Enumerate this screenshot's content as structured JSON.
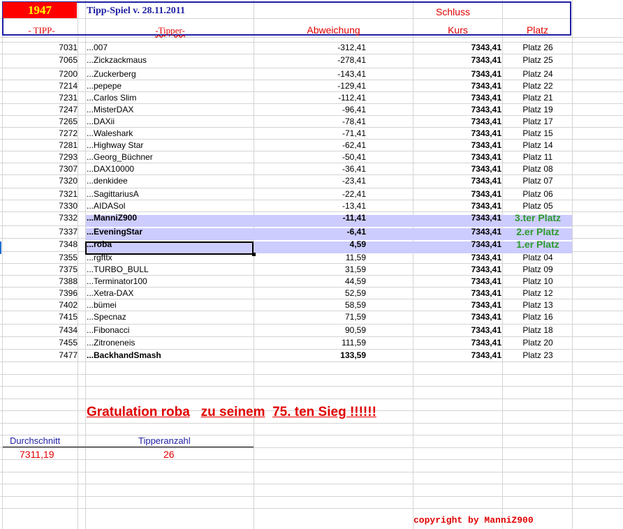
{
  "header": {
    "year": "1947",
    "title": "Tipp-Spiel v. 28.11.2011",
    "schluss_label": "Schluss",
    "col_tipp": "- TIPP-",
    "col_tipper": "-Tipper-",
    "col_abweichung": "Abweichung",
    "col_kurs": "Kurs",
    "col_platz": "Platz"
  },
  "rows": [
    {
      "tipp": "7031",
      "name": "...007",
      "dev": "-312,41",
      "kurs": "7343,41",
      "platz": "Platz 26"
    },
    {
      "tipp": "7065",
      "name": "...Zickzackmaus",
      "dev": "-278,41",
      "kurs": "7343,41",
      "platz": "Platz 25"
    },
    {
      "tipp": "7200",
      "name": "...Zuckerberg",
      "dev": "-143,41",
      "kurs": "7343,41",
      "platz": "Platz 24"
    },
    {
      "tipp": "7214",
      "name": "...pepepe",
      "dev": "-129,41",
      "kurs": "7343,41",
      "platz": "Platz 22"
    },
    {
      "tipp": "7231",
      "name": "...Carlos Slim",
      "dev": "-112,41",
      "kurs": "7343,41",
      "platz": "Platz 21"
    },
    {
      "tipp": "7247",
      "name": "...MisterDAX",
      "dev": "-96,41",
      "kurs": "7343,41",
      "platz": "Platz 19"
    },
    {
      "tipp": "7265",
      "name": "...DAXii",
      "dev": "-78,41",
      "kurs": "7343,41",
      "platz": "Platz 17"
    },
    {
      "tipp": "7272",
      "name": "...Waleshark",
      "dev": "-71,41",
      "kurs": "7343,41",
      "platz": "Platz 15"
    },
    {
      "tipp": "7281",
      "name": "...Highway Star",
      "dev": "-62,41",
      "kurs": "7343,41",
      "platz": "Platz 14"
    },
    {
      "tipp": "7293",
      "name": "...Georg_Büchner",
      "dev": "-50,41",
      "kurs": "7343,41",
      "platz": "Platz 11"
    },
    {
      "tipp": "7307",
      "name": "...DAX10000",
      "dev": "-36,41",
      "kurs": "7343,41",
      "platz": "Platz 08"
    },
    {
      "tipp": "7320",
      "name": "...denkidee",
      "dev": "-23,41",
      "kurs": "7343,41",
      "platz": "Platz 07"
    },
    {
      "tipp": "7321",
      "name": "...SagittariusA",
      "dev": "-22,41",
      "kurs": "7343,41",
      "platz": "Platz 06"
    },
    {
      "tipp": "7330",
      "name": "...AIDASol",
      "dev": "-13,41",
      "kurs": "7343,41",
      "platz": "Platz 05"
    },
    {
      "tipp": "7332",
      "name": "...ManniZ900",
      "dev": "-11,41",
      "kurs": "7343,41",
      "platz": "3.ter Platz"
    },
    {
      "tipp": "7337",
      "name": "...EveningStar",
      "dev": "-6,41",
      "kurs": "7343,41",
      "platz": "2.er Platz"
    },
    {
      "tipp": "7348",
      "name": "...roba",
      "dev": "4,59",
      "kurs": "7343,41",
      "platz": "1.er Platz"
    },
    {
      "tipp": "7355",
      "name": "...rgfttx",
      "dev": "11,59",
      "kurs": "7343,41",
      "platz": "Platz 04"
    },
    {
      "tipp": "7375",
      "name": "...TURBO_BULL",
      "dev": "31,59",
      "kurs": "7343,41",
      "platz": "Platz 09"
    },
    {
      "tipp": "7388",
      "name": "...Terminator100",
      "dev": "44,59",
      "kurs": "7343,41",
      "platz": "Platz 10"
    },
    {
      "tipp": "7396",
      "name": "...Xetra-DAX",
      "dev": "52,59",
      "kurs": "7343,41",
      "platz": "Platz 12"
    },
    {
      "tipp": "7402",
      "name": "...bümei",
      "dev": "58,59",
      "kurs": "7343,41",
      "platz": "Platz 13"
    },
    {
      "tipp": "7415",
      "name": "...Specnaz",
      "dev": "71,59",
      "kurs": "7343,41",
      "platz": "Platz 16"
    },
    {
      "tipp": "7434",
      "name": "...Fibonacci",
      "dev": "90,59",
      "kurs": "7343,41",
      "platz": "Platz 18"
    },
    {
      "tipp": "7455",
      "name": "...Zitroneneis",
      "dev": "111,59",
      "kurs": "7343,41",
      "platz": "Platz 20"
    },
    {
      "tipp": "7477",
      "name": "...BackhandSmash",
      "dev": "133,59",
      "kurs": "7343,41",
      "platz": "Platz 23"
    }
  ],
  "congrats": {
    "part1": "Gratulation roba",
    "part2": "zu seinem",
    "part3": "75. ten Sieg !!!!!!"
  },
  "stats": {
    "avg_label": "Durchschnitt",
    "avg_value": "7311,19",
    "count_label": "Tipperanzahl",
    "count_value": "26"
  },
  "copyright": "copyright by ManniZ900",
  "colors": {
    "accent_red": "#e00000",
    "header_blue": "#1f1fa3",
    "highlight": "#ccccff",
    "winner_green": "#2d9a2d"
  }
}
